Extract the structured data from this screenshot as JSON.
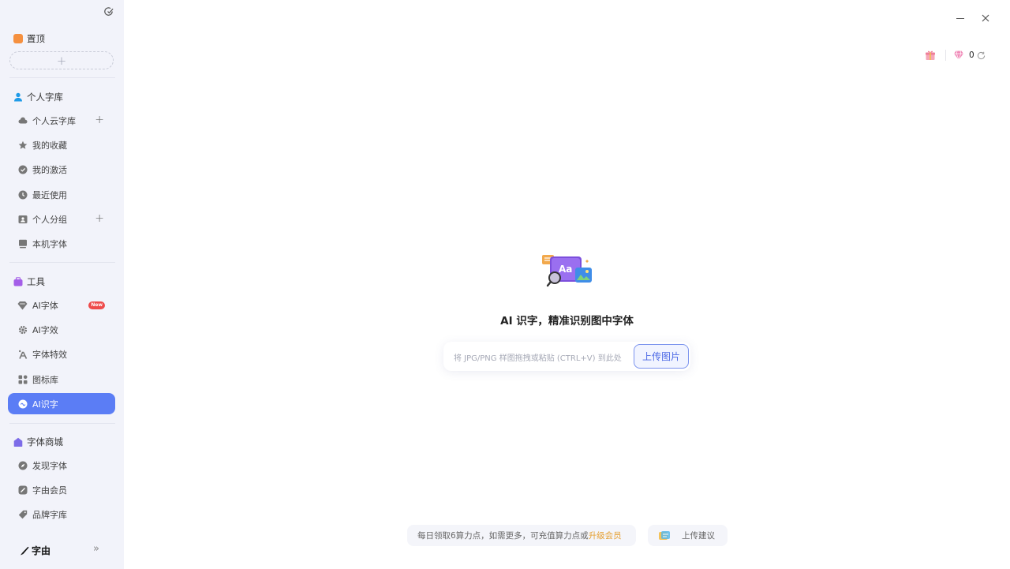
{
  "sidebar": {
    "pinned": {
      "title": "置顶",
      "add_label": "+"
    },
    "personal": {
      "title": "个人字库",
      "items": [
        {
          "label": "个人云字库",
          "plus": "+"
        },
        {
          "label": "我的收藏"
        },
        {
          "label": "我的激活"
        },
        {
          "label": "最近使用"
        },
        {
          "label": "个人分组",
          "plus": "+"
        },
        {
          "label": "本机字体"
        }
      ]
    },
    "tools": {
      "title": "工具",
      "items": [
        {
          "label": "AI字体",
          "badge": "New"
        },
        {
          "label": "AI字效"
        },
        {
          "label": "字体特效"
        },
        {
          "label": "图标库"
        },
        {
          "label": "AI识字"
        }
      ]
    },
    "store": {
      "title": "字体商城",
      "items": [
        {
          "label": "发现字体"
        },
        {
          "label": "字由会员"
        },
        {
          "label": "品牌字库"
        }
      ]
    },
    "footer": {
      "logo": "字由",
      "expand": "»"
    }
  },
  "header": {
    "credits": "0"
  },
  "main": {
    "title": "AI 识字，精准识别图中字体",
    "drop_hint": "将 JPG/PNG 样图拖拽或粘贴 (CTRL+V) 到此处",
    "upload_button": "上传图片"
  },
  "bottom": {
    "notice": "每日领取6算力点，如需更多，可充值算力点或 ",
    "upgrade": "升级会员",
    "feedback": "上传建议"
  },
  "colors": {
    "accent": "#5b7df5",
    "upgrade": "#e59e2e",
    "badge": "#ee4b4b"
  }
}
